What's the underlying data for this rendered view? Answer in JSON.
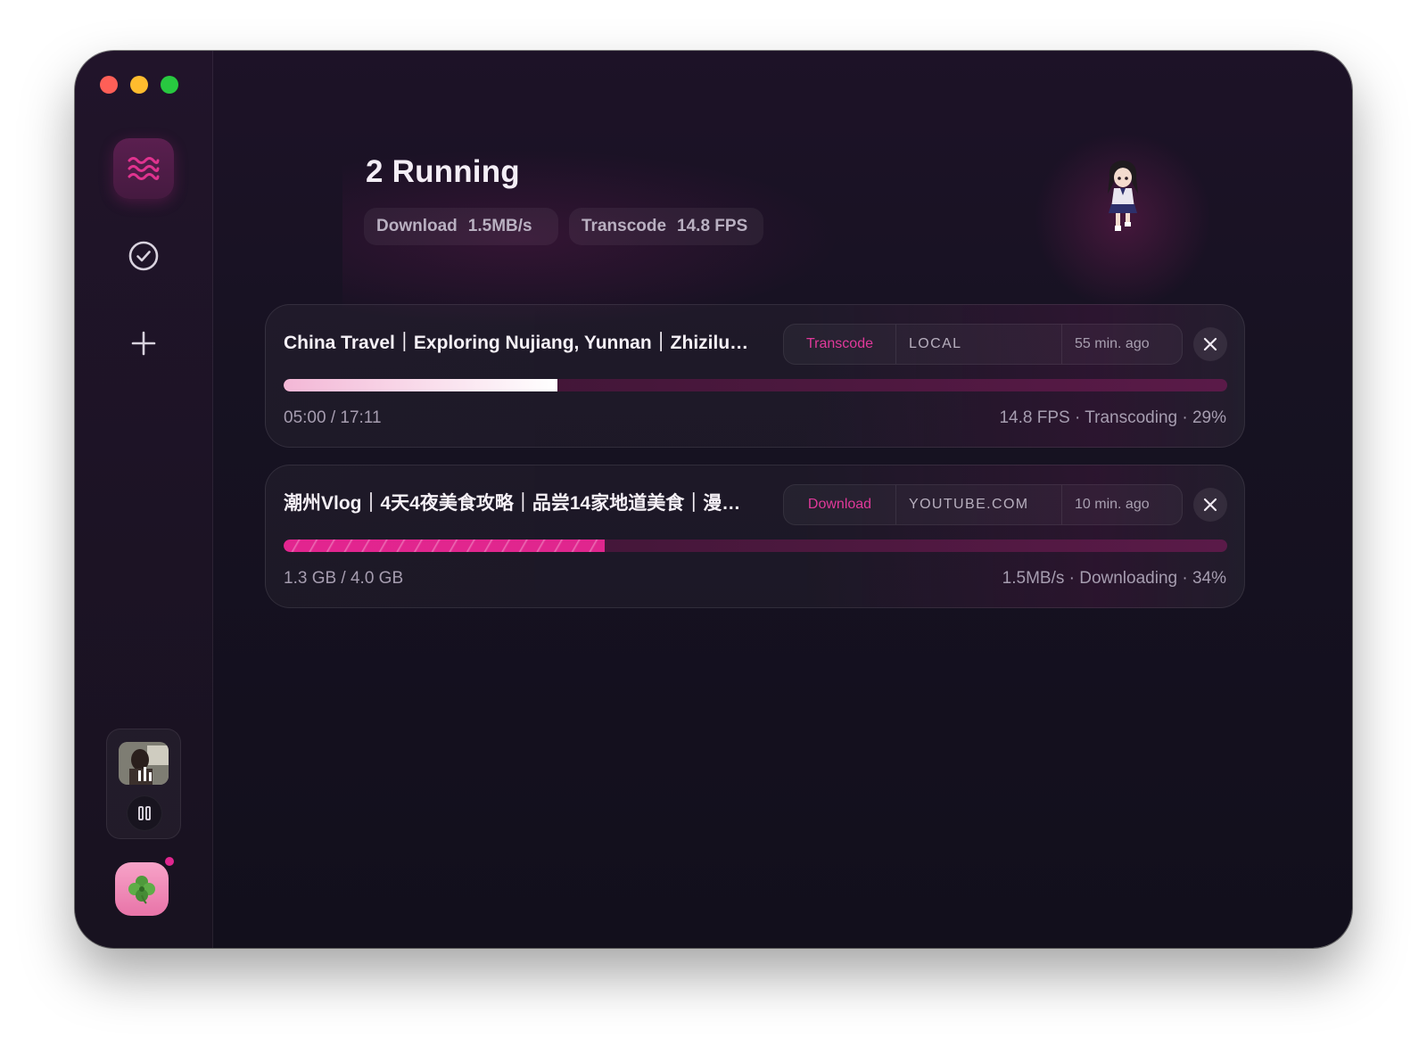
{
  "header": {
    "title": "2 Running",
    "stats": [
      {
        "label": "Download",
        "value": "1.5MB/s"
      },
      {
        "label": "Transcode",
        "value": "14.8 FPS"
      }
    ]
  },
  "sidebar": {
    "items": [
      {
        "name": "tasks",
        "icon": "waves-icon",
        "active": true
      },
      {
        "name": "completed",
        "icon": "check-circle-icon",
        "active": false
      },
      {
        "name": "add",
        "icon": "plus-icon",
        "active": false
      }
    ],
    "player": {
      "state": "playing",
      "control_icon": "pause-icon"
    },
    "profile_icon": "clover-icon",
    "notification": true
  },
  "tasks": [
    {
      "title": "China Travel｜Exploring Nujiang, Yunnan｜Zhizilu…",
      "type": "Transcode",
      "source": "LOCAL",
      "time": "55 min. ago",
      "progress": 0.29,
      "left_text": "05:00 / 17:11",
      "right_text": "14.8 FPS · Transcoding · 29%"
    },
    {
      "title": "潮州Vlog｜4天4夜美食攻略｜品尝14家地道美食｜漫…",
      "type": "Download",
      "source": "YOUTUBE.COM",
      "time": "10 min. ago",
      "progress": 0.34,
      "left_text": "1.3 GB / 4.0 GB",
      "right_text": "1.5MB/s · Downloading · 34%"
    }
  ],
  "colors": {
    "accent": "#e0268f",
    "background": "#130f1c",
    "sidebar": "#1c1324"
  }
}
